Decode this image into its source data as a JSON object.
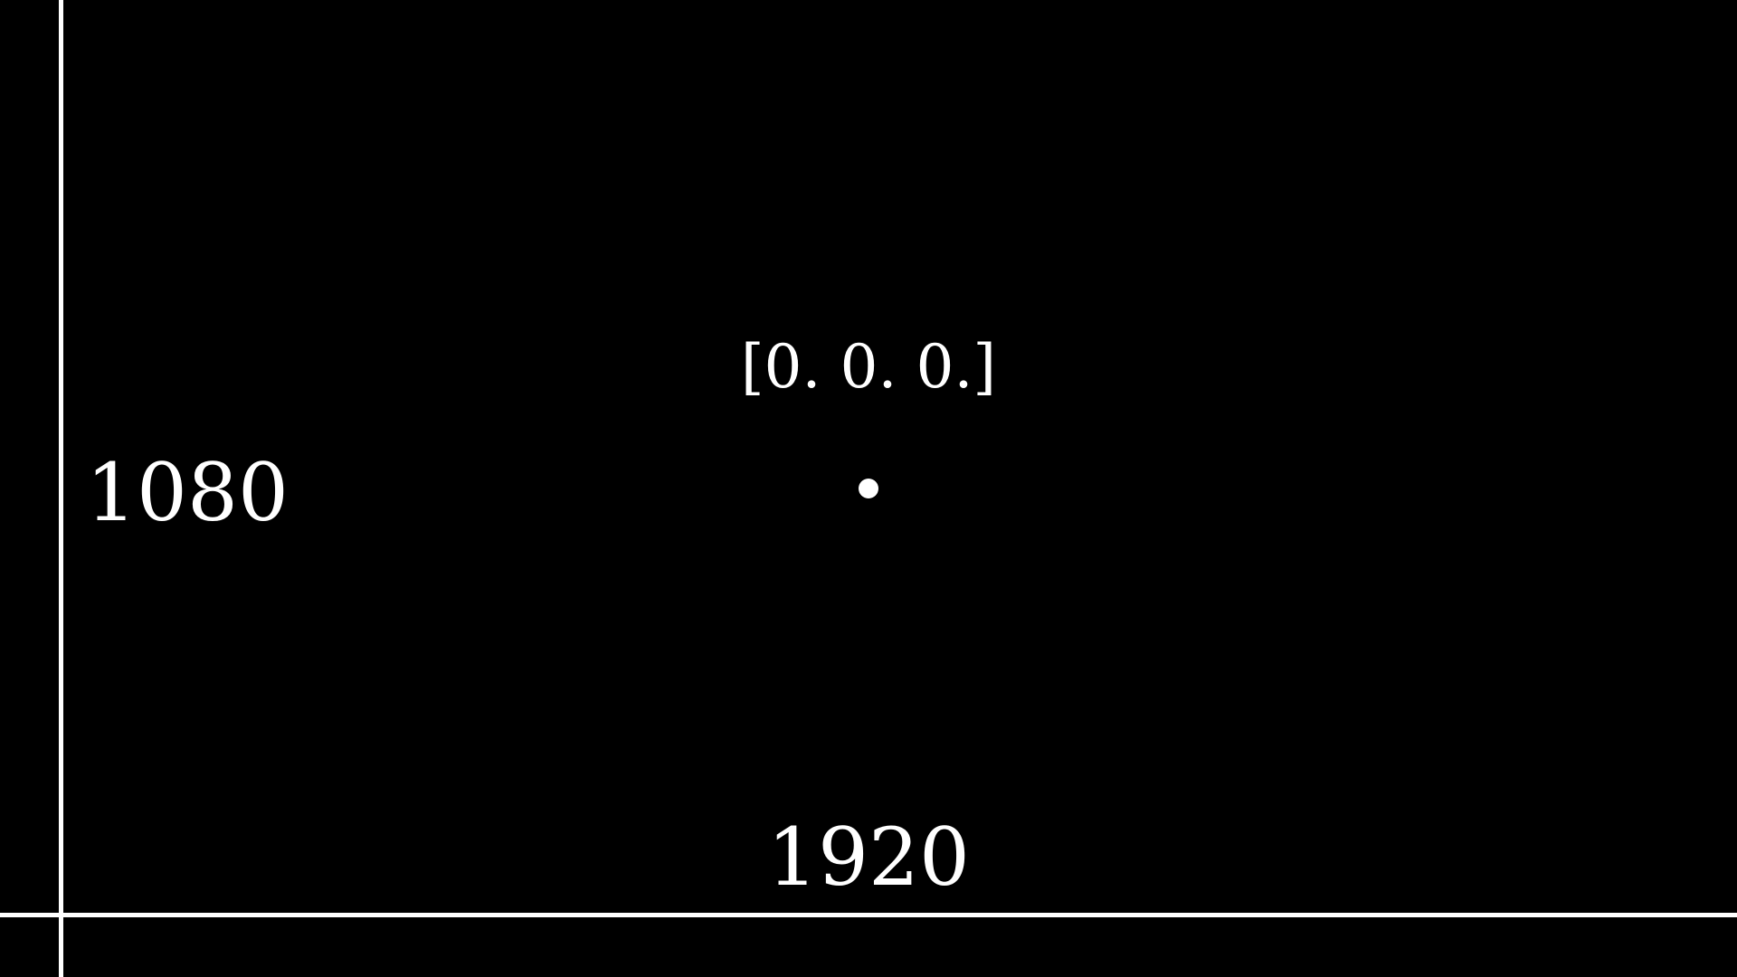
{
  "screen": {
    "center_coordinate_text": "[0. 0. 0.]",
    "height_label": "1080",
    "width_label": "1920",
    "background_color": "#000000",
    "foreground_color": "#ffffff"
  }
}
